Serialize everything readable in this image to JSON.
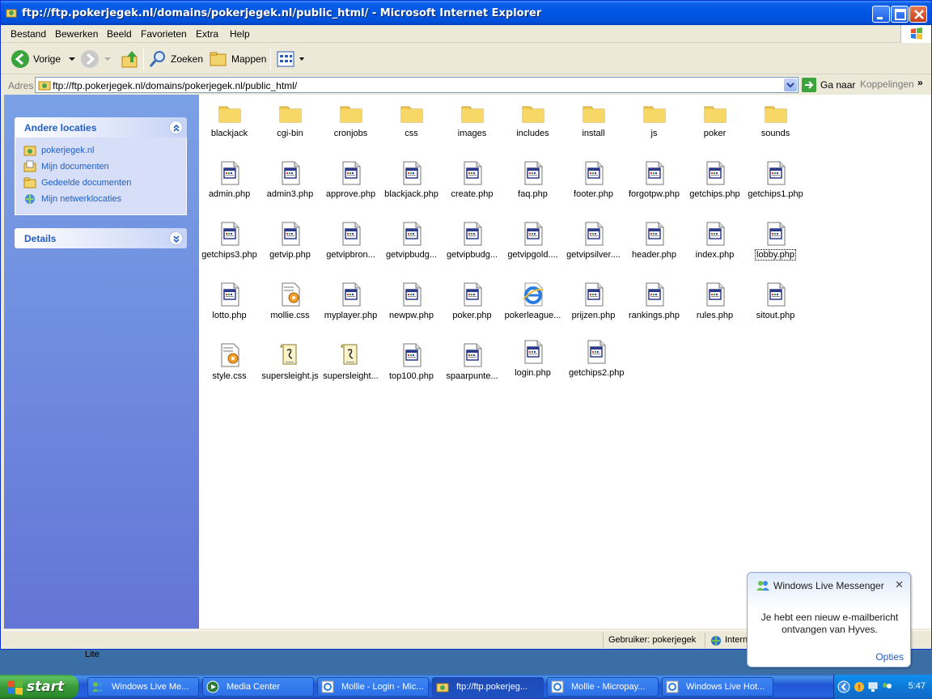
{
  "window": {
    "title": "ftp://ftp.pokerjegek.nl/domains/pokerjegek.nl/public_html/ - Microsoft Internet Explorer"
  },
  "menu": [
    "Bestand",
    "Bewerken",
    "Beeld",
    "Favorieten",
    "Extra",
    "Help"
  ],
  "toolbar": {
    "back_label": "Vorige",
    "search_label": "Zoeken",
    "folders_label": "Mappen"
  },
  "address": {
    "label": "Adres",
    "value": "ftp://ftp.pokerjegek.nl/domains/pokerjegek.nl/public_html/",
    "go_label": "Ga naar",
    "links_label": "Koppelingen"
  },
  "sidebar": {
    "other_locations": {
      "title": "Andere locaties",
      "items": [
        {
          "label": "pokerjegek.nl",
          "icon": "ftp-site-icon"
        },
        {
          "label": "Mijn documenten",
          "icon": "my-documents-icon"
        },
        {
          "label": "Gedeelde documenten",
          "icon": "shared-documents-icon"
        },
        {
          "label": "Mijn netwerklocaties",
          "icon": "network-places-icon"
        }
      ]
    },
    "details": {
      "title": "Details"
    }
  },
  "files": [
    {
      "name": "blackjack",
      "type": "folder"
    },
    {
      "name": "cgi-bin",
      "type": "folder"
    },
    {
      "name": "cronjobs",
      "type": "folder"
    },
    {
      "name": "css",
      "type": "folder"
    },
    {
      "name": "images",
      "type": "folder"
    },
    {
      "name": "includes",
      "type": "folder"
    },
    {
      "name": "install",
      "type": "folder"
    },
    {
      "name": "js",
      "type": "folder"
    },
    {
      "name": "poker",
      "type": "folder"
    },
    {
      "name": "sounds",
      "type": "folder"
    },
    {
      "name": "admin.php",
      "type": "php"
    },
    {
      "name": "admin3.php",
      "type": "php"
    },
    {
      "name": "approve.php",
      "type": "php"
    },
    {
      "name": "blackjack.php",
      "type": "php"
    },
    {
      "name": "create.php",
      "type": "php"
    },
    {
      "name": "faq.php",
      "type": "php"
    },
    {
      "name": "footer.php",
      "type": "php"
    },
    {
      "name": "forgotpw.php",
      "type": "php"
    },
    {
      "name": "getchips.php",
      "type": "php"
    },
    {
      "name": "getchips1.php",
      "type": "php"
    },
    {
      "name": "getchips3.php",
      "type": "php"
    },
    {
      "name": "getvip.php",
      "type": "php"
    },
    {
      "name": "getvipbron...",
      "type": "php"
    },
    {
      "name": "getvipbudg...",
      "type": "php"
    },
    {
      "name": "getvipbudg...",
      "type": "php"
    },
    {
      "name": "getvipgold....",
      "type": "php"
    },
    {
      "name": "getvipsilver....",
      "type": "php"
    },
    {
      "name": "header.php",
      "type": "php"
    },
    {
      "name": "index.php",
      "type": "php"
    },
    {
      "name": "lobby.php",
      "type": "php",
      "selected": true
    },
    {
      "name": "lotto.php",
      "type": "php"
    },
    {
      "name": "mollie.css",
      "type": "css"
    },
    {
      "name": "myplayer.php",
      "type": "php"
    },
    {
      "name": "newpw.php",
      "type": "php"
    },
    {
      "name": "poker.php",
      "type": "php"
    },
    {
      "name": "pokerleague...",
      "type": "html"
    },
    {
      "name": "prijzen.php",
      "type": "php"
    },
    {
      "name": "rankings.php",
      "type": "php"
    },
    {
      "name": "rules.php",
      "type": "php"
    },
    {
      "name": "sitout.php",
      "type": "php"
    },
    {
      "name": "style.css",
      "type": "css"
    },
    {
      "name": "supersleight.js",
      "type": "js"
    },
    {
      "name": "supersleight...",
      "type": "js"
    },
    {
      "name": "top100.php",
      "type": "php"
    },
    {
      "name": "spaarpunte...",
      "type": "php"
    },
    {
      "name": "login.php",
      "type": "php"
    },
    {
      "name": "getchips2.php",
      "type": "php"
    }
  ],
  "status": {
    "user": "Gebruiker: pokerjegek",
    "zone": "Internet"
  },
  "below_window_text": "Lite",
  "taskbar": {
    "start_label": "start",
    "tasks": [
      {
        "label": "Windows Live Me...",
        "icon": "messenger-icon"
      },
      {
        "label": "Media Center",
        "icon": "media-center-icon"
      },
      {
        "label": "Mollie - Login - Mic...",
        "icon": "ie-icon"
      },
      {
        "label": "ftp://ftp.pokerjeg...",
        "icon": "ftp-icon",
        "active": true
      },
      {
        "label": "Mollie - Micropay...",
        "icon": "ie-icon"
      },
      {
        "label": "Windows Live Hot...",
        "icon": "ie-icon"
      }
    ],
    "clock": "5:47"
  },
  "notification": {
    "title": "Windows Live Messenger",
    "message": "Je hebt een nieuw e-mailbericht ontvangen van Hyves.",
    "options_label": "Opties"
  },
  "colors": {
    "titlebar": "#0056e4",
    "sidebar_link": "#215dc6",
    "taskbar": "#2157d7",
    "start": "#3a9a3a"
  }
}
